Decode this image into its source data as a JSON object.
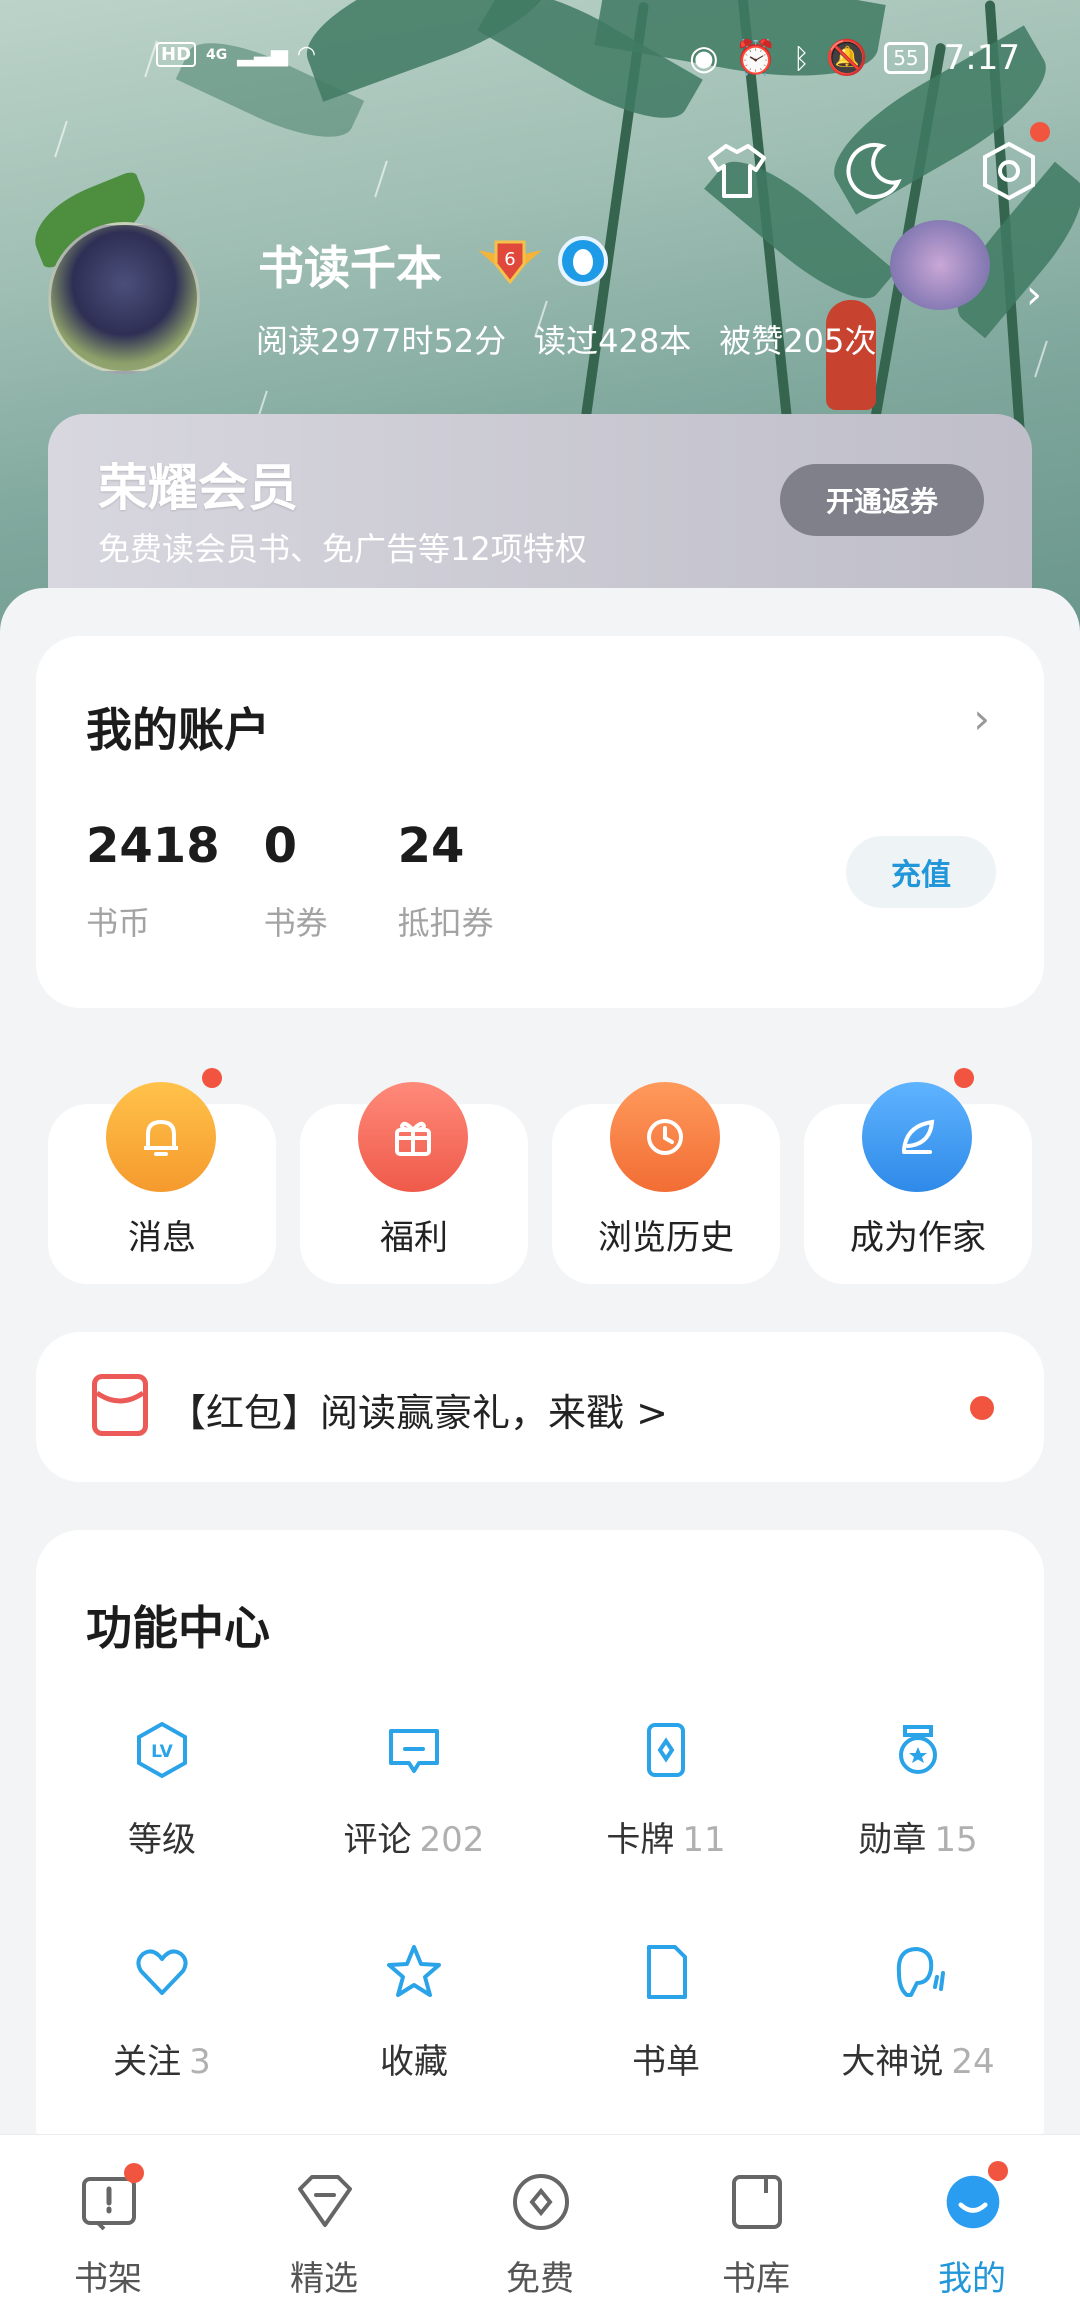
{
  "status_bar": {
    "network_left": "HD",
    "network_type": "4G",
    "battery": "55",
    "time": "7:17"
  },
  "profile": {
    "name": "书读千本",
    "level_badge": "6",
    "stats": [
      "阅读2977时52分",
      "读过428本",
      "被赞205次"
    ]
  },
  "vip": {
    "title": "荣耀会员",
    "subtitle": "免费读会员书、免广告等12项特权",
    "button": "开通返券"
  },
  "account": {
    "title": "我的账户",
    "items": [
      {
        "value": "2418",
        "label": "书币"
      },
      {
        "value": "0",
        "label": "书券"
      },
      {
        "value": "24",
        "label": "抵扣券"
      }
    ],
    "recharge": "充值"
  },
  "quick_actions": [
    {
      "label": "消息",
      "icon": "bell-icon",
      "color": "#f7a436",
      "dot": true
    },
    {
      "label": "福利",
      "icon": "gift-icon",
      "color": "#f0614f",
      "dot": false
    },
    {
      "label": "浏览历史",
      "icon": "clock-icon",
      "color": "#f7743d",
      "dot": false
    },
    {
      "label": "成为作家",
      "icon": "feather-icon",
      "color": "#3d9bef",
      "dot": true
    }
  ],
  "promo": {
    "text": "【红包】阅读赢豪礼，来戳 >"
  },
  "features": {
    "title": "功能中心",
    "items": [
      {
        "label": "等级",
        "count": "",
        "icon": "level-icon"
      },
      {
        "label": "评论",
        "count": "202",
        "icon": "comment-icon"
      },
      {
        "label": "卡牌",
        "count": "11",
        "icon": "card-icon"
      },
      {
        "label": "勋章",
        "count": "15",
        "icon": "medal-icon"
      },
      {
        "label": "关注",
        "count": "3",
        "icon": "heart-icon"
      },
      {
        "label": "收藏",
        "count": "",
        "icon": "star-icon"
      },
      {
        "label": "书单",
        "count": "",
        "icon": "booklist-icon"
      },
      {
        "label": "大神说",
        "count": "24",
        "icon": "speaker-icon"
      }
    ]
  },
  "bottom_nav": [
    {
      "label": "书架",
      "icon": "bookshelf-icon",
      "dot": true
    },
    {
      "label": "精选",
      "icon": "diamond-icon",
      "dot": false
    },
    {
      "label": "免费",
      "icon": "free-icon",
      "dot": false
    },
    {
      "label": "书库",
      "icon": "library-icon",
      "dot": false
    },
    {
      "label": "我的",
      "icon": "me-icon",
      "dot": true,
      "active": true
    }
  ],
  "colors": {
    "accent": "#2196d8",
    "badge_red": "#f2553f"
  }
}
